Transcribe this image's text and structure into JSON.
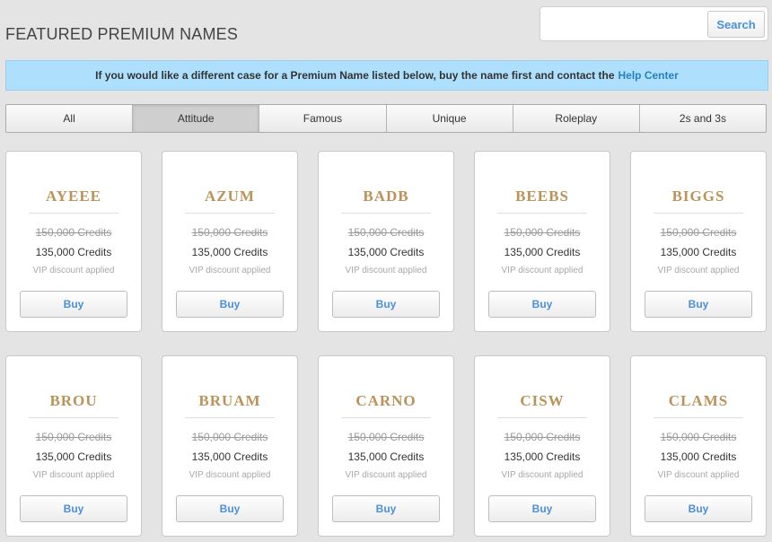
{
  "header": {
    "title": "FEATURED PREMIUM NAMES"
  },
  "search": {
    "value": "",
    "placeholder": "",
    "button_label": "Search"
  },
  "banner": {
    "text": "If you would like a different case for a Premium Name listed below, buy the name first and contact the",
    "link_label": "Help Center"
  },
  "tabs": [
    {
      "label": "All",
      "active": false
    },
    {
      "label": "Attitude",
      "active": true
    },
    {
      "label": "Famous",
      "active": false
    },
    {
      "label": "Unique",
      "active": false
    },
    {
      "label": "Roleplay",
      "active": false
    },
    {
      "label": "2s and 3s",
      "active": false
    }
  ],
  "cards": [
    {
      "name": "AYEEE",
      "old_price": "150,000 Credits",
      "price": "135,000 Credits",
      "note": "VIP discount applied",
      "button_label": "Buy"
    },
    {
      "name": "AZUM",
      "old_price": "150,000 Credits",
      "price": "135,000 Credits",
      "note": "VIP discount applied",
      "button_label": "Buy"
    },
    {
      "name": "BADB",
      "old_price": "150,000 Credits",
      "price": "135,000 Credits",
      "note": "VIP discount applied",
      "button_label": "Buy"
    },
    {
      "name": "BEEBS",
      "old_price": "150,000 Credits",
      "price": "135,000 Credits",
      "note": "VIP discount applied",
      "button_label": "Buy"
    },
    {
      "name": "BIGGS",
      "old_price": "150,000 Credits",
      "price": "135,000 Credits",
      "note": "VIP discount applied",
      "button_label": "Buy"
    },
    {
      "name": "BROU",
      "old_price": "150,000 Credits",
      "price": "135,000 Credits",
      "note": "VIP discount applied",
      "button_label": "Buy"
    },
    {
      "name": "BRUAM",
      "old_price": "150,000 Credits",
      "price": "135,000 Credits",
      "note": "VIP discount applied",
      "button_label": "Buy"
    },
    {
      "name": "CARNO",
      "old_price": "150,000 Credits",
      "price": "135,000 Credits",
      "note": "VIP discount applied",
      "button_label": "Buy"
    },
    {
      "name": "CISW",
      "old_price": "150,000 Credits",
      "price": "135,000 Credits",
      "note": "VIP discount applied",
      "button_label": "Buy"
    },
    {
      "name": "CLAMS",
      "old_price": "150,000 Credits",
      "price": "135,000 Credits",
      "note": "VIP discount applied",
      "button_label": "Buy"
    }
  ],
  "colors": {
    "accent": "#4a90d9",
    "name_gold": "#b9935a",
    "banner_bg": "#aee0fd",
    "link": "#2a7fc0"
  }
}
